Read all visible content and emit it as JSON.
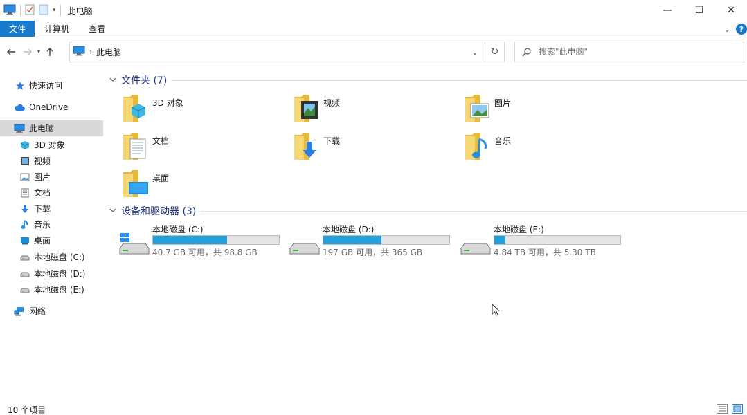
{
  "titlebar": {
    "title": "此电脑",
    "minimize": "—",
    "maximize": "☐",
    "close": "✕"
  },
  "ribbon": {
    "tabs": [
      "文件",
      "计算机",
      "查看"
    ],
    "help": "?"
  },
  "address": {
    "path": "此电脑",
    "search_placeholder": "搜索\"此电脑\""
  },
  "sidebar": {
    "items": [
      {
        "label": "快速访问",
        "icon": "star-icon"
      },
      {
        "label": "OneDrive",
        "icon": "cloud-icon"
      },
      {
        "label": "此电脑",
        "icon": "computer-icon",
        "selected": true
      },
      {
        "label": "3D 对象",
        "icon": "cube-icon"
      },
      {
        "label": "视频",
        "icon": "video-icon"
      },
      {
        "label": "图片",
        "icon": "picture-icon"
      },
      {
        "label": "文档",
        "icon": "document-icon"
      },
      {
        "label": "下载",
        "icon": "download-icon"
      },
      {
        "label": "音乐",
        "icon": "music-icon"
      },
      {
        "label": "桌面",
        "icon": "desktop-icon"
      },
      {
        "label": "本地磁盘 (C:)",
        "icon": "drive-icon"
      },
      {
        "label": "本地磁盘 (D:)",
        "icon": "drive-icon"
      },
      {
        "label": "本地磁盘 (E:)",
        "icon": "drive-icon"
      },
      {
        "label": "网络",
        "icon": "network-icon"
      }
    ]
  },
  "main": {
    "folders_header": "文件夹 (7)",
    "folders": [
      {
        "label": "3D 对象",
        "icon": "cube-icon"
      },
      {
        "label": "视频",
        "icon": "video-icon"
      },
      {
        "label": "图片",
        "icon": "picture-icon"
      },
      {
        "label": "文档",
        "icon": "document-icon"
      },
      {
        "label": "下载",
        "icon": "download-icon"
      },
      {
        "label": "音乐",
        "icon": "music-icon"
      },
      {
        "label": "桌面",
        "icon": "desktop-icon"
      }
    ],
    "drives_header": "设备和驱动器 (3)",
    "drives": [
      {
        "name": "本地磁盘 (C:)",
        "free": "40.7 GB 可用，共 98.8 GB",
        "used_fraction": 0.588,
        "windows": true
      },
      {
        "name": "本地磁盘 (D:)",
        "free": "197 GB 可用，共 365 GB",
        "used_fraction": 0.46,
        "windows": false
      },
      {
        "name": "本地磁盘 (E:)",
        "free": "4.84 TB 可用，共 5.30 TB",
        "used_fraction": 0.087,
        "windows": false
      }
    ]
  },
  "status": {
    "count": "10 个项目"
  },
  "colors": {
    "accent": "#1979ca",
    "drive_bar": "#26a0da",
    "group_header": "#1e3287",
    "folder_yellow": "#f8d775"
  }
}
